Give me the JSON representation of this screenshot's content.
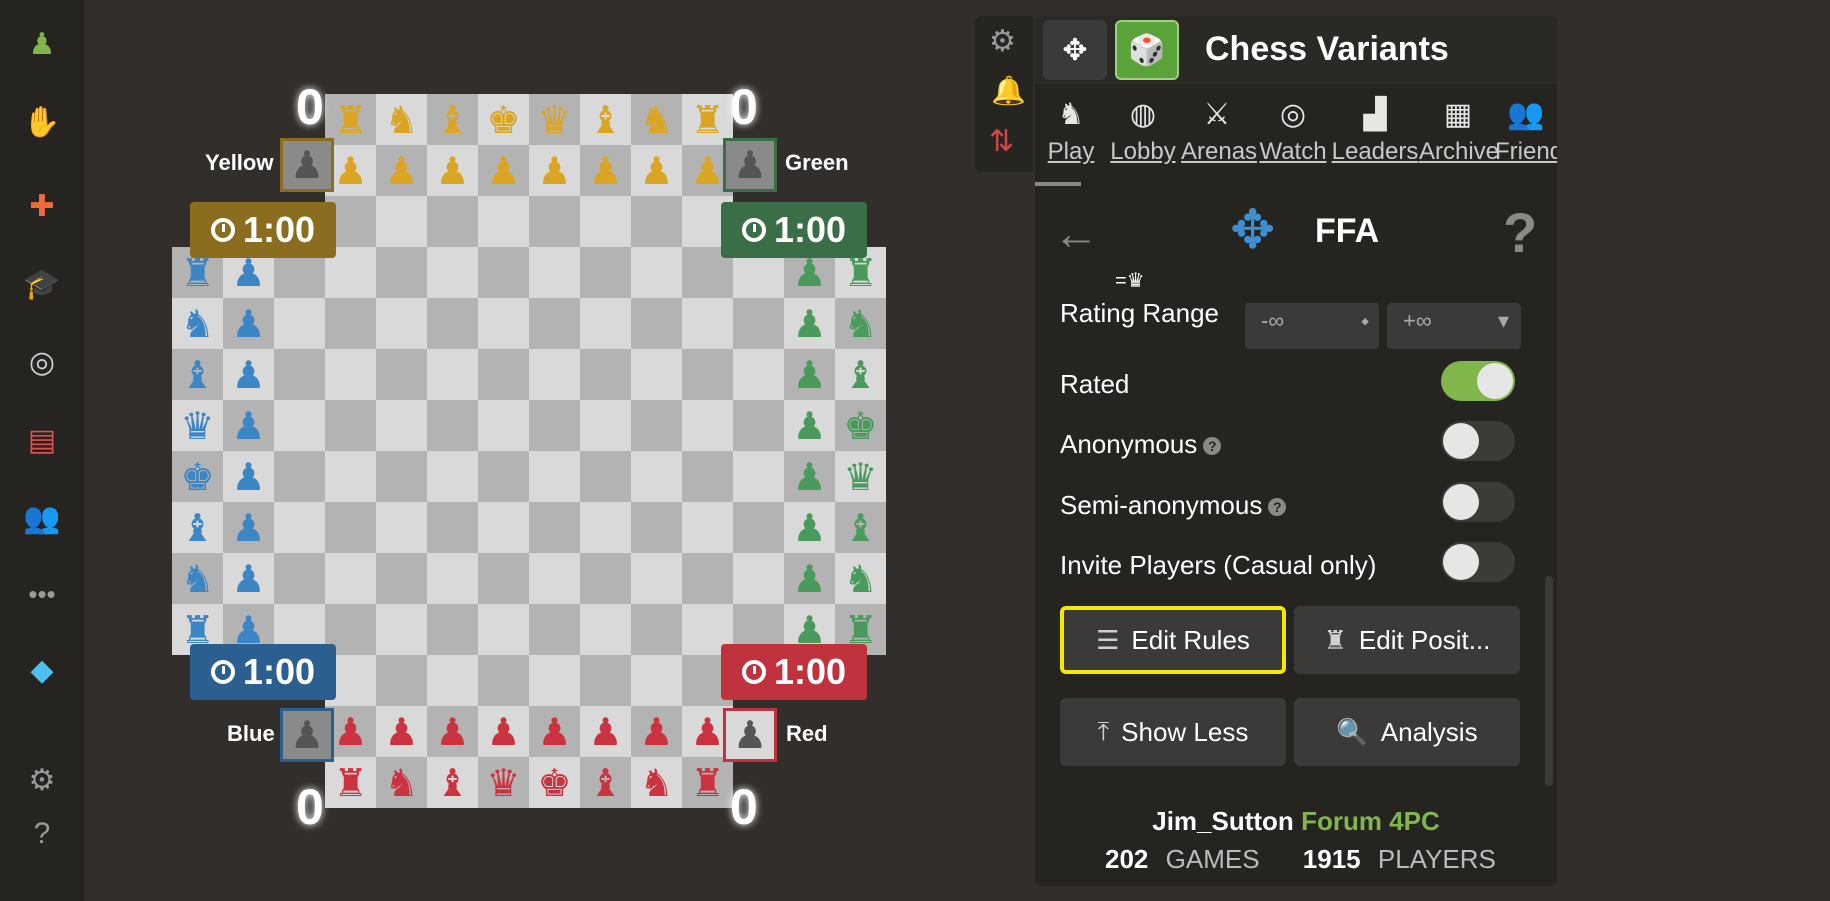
{
  "left_sidebar": {
    "icons": [
      "pawn-logo-icon",
      "hand-piece-icon",
      "puzzle-icon",
      "graduation-cap-icon",
      "binoculars-icon",
      "news-icon",
      "friends-icon",
      "more-icon",
      "diamond-icon",
      "settings-icon",
      "help-icon"
    ]
  },
  "board": {
    "players": {
      "yellow": {
        "name": "Yellow",
        "score": "0",
        "clock": "1:00",
        "color": "#8c6d1f",
        "piece_color": "#d9a522"
      },
      "green": {
        "name": "Green",
        "score": "0",
        "clock": "1:00",
        "color": "#3a6e46",
        "piece_color": "#4a9a5c"
      },
      "blue": {
        "name": "Blue",
        "score": "0",
        "clock": "1:00",
        "color": "#2b5f8f",
        "piece_color": "#3d86c6"
      },
      "red": {
        "name": "Red",
        "score": "0",
        "clock": "1:00",
        "color": "#c0323e",
        "piece_color": "#cc3340"
      }
    }
  },
  "panel": {
    "title": "Chess Variants",
    "tabs": [
      "Play",
      "Lobby",
      "Arenas",
      "Watch",
      "Leaders",
      "Archive",
      "Friends"
    ],
    "mode_title": "FFA",
    "promotion_hint": "=♛",
    "rating_range": {
      "label": "Rating Range",
      "min": "-∞",
      "max": "+∞"
    },
    "options": [
      {
        "label": "Rated",
        "on": true,
        "help": false
      },
      {
        "label": "Anonymous",
        "on": false,
        "help": true
      },
      {
        "label": "Semi-anonymous",
        "on": false,
        "help": true
      },
      {
        "label": "Invite Players (Casual only)",
        "on": false,
        "help": false
      }
    ],
    "buttons": {
      "edit_rules": "Edit Rules",
      "edit_position": "Edit Posit...",
      "show_less": "Show Less",
      "analysis": "Analysis"
    },
    "footer": {
      "user": "Jim_Sutton",
      "forum": "Forum 4PC",
      "games_count": "202",
      "games_label": "GAMES",
      "players_count": "1915",
      "players_label": "PLAYERS"
    },
    "help_symbol": "?"
  }
}
